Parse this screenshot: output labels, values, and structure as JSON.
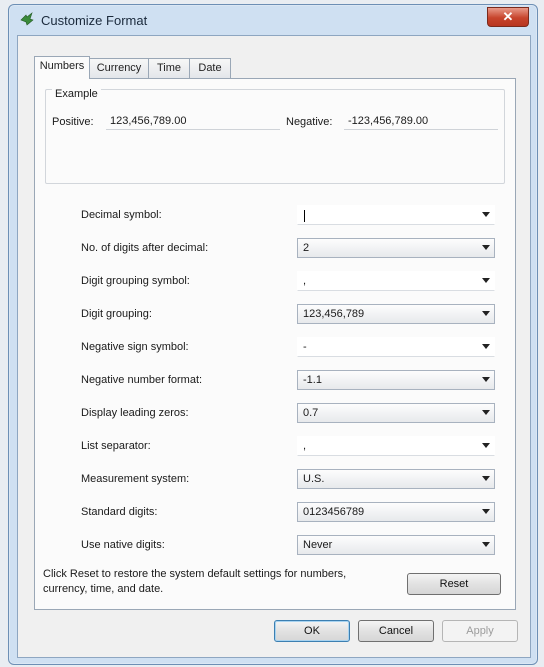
{
  "window": {
    "title": "Customize Format",
    "close_label": "✕"
  },
  "tabs": [
    {
      "label": "Numbers",
      "active": true
    },
    {
      "label": "Currency",
      "active": false
    },
    {
      "label": "Time",
      "active": false
    },
    {
      "label": "Date",
      "active": false
    }
  ],
  "example": {
    "group_label": "Example",
    "positive_label": "Positive:",
    "positive_value": "123,456,789.00",
    "negative_label": "Negative:",
    "negative_value": "-123,456,789.00"
  },
  "settings": [
    {
      "label": "Decimal symbol:",
      "value": "",
      "editable": true
    },
    {
      "label": "No. of digits after decimal:",
      "value": "2",
      "editable": false
    },
    {
      "label": "Digit grouping symbol:",
      "value": ",",
      "editable": true
    },
    {
      "label": "Digit grouping:",
      "value": "123,456,789",
      "editable": false
    },
    {
      "label": "Negative sign symbol:",
      "value": "-",
      "editable": true
    },
    {
      "label": "Negative number format:",
      "value": "-1.1",
      "editable": false
    },
    {
      "label": "Display leading zeros:",
      "value": "0.7",
      "editable": false
    },
    {
      "label": "List separator:",
      "value": ",",
      "editable": true
    },
    {
      "label": "Measurement system:",
      "value": "U.S.",
      "editable": false
    },
    {
      "label": "Standard digits:",
      "value": "0123456789",
      "editable": false
    },
    {
      "label": "Use native digits:",
      "value": "Never",
      "editable": false
    }
  ],
  "footer": {
    "reset_note": "Click Reset to restore the system default settings for numbers, currency, time, and date.",
    "reset_label": "Reset"
  },
  "buttons": {
    "ok_label": "OK",
    "cancel_label": "Cancel",
    "apply_label": "Apply"
  },
  "icons": {
    "title_icon": "control-panel-icon",
    "dropdown_icon": "chevron-down-icon"
  }
}
